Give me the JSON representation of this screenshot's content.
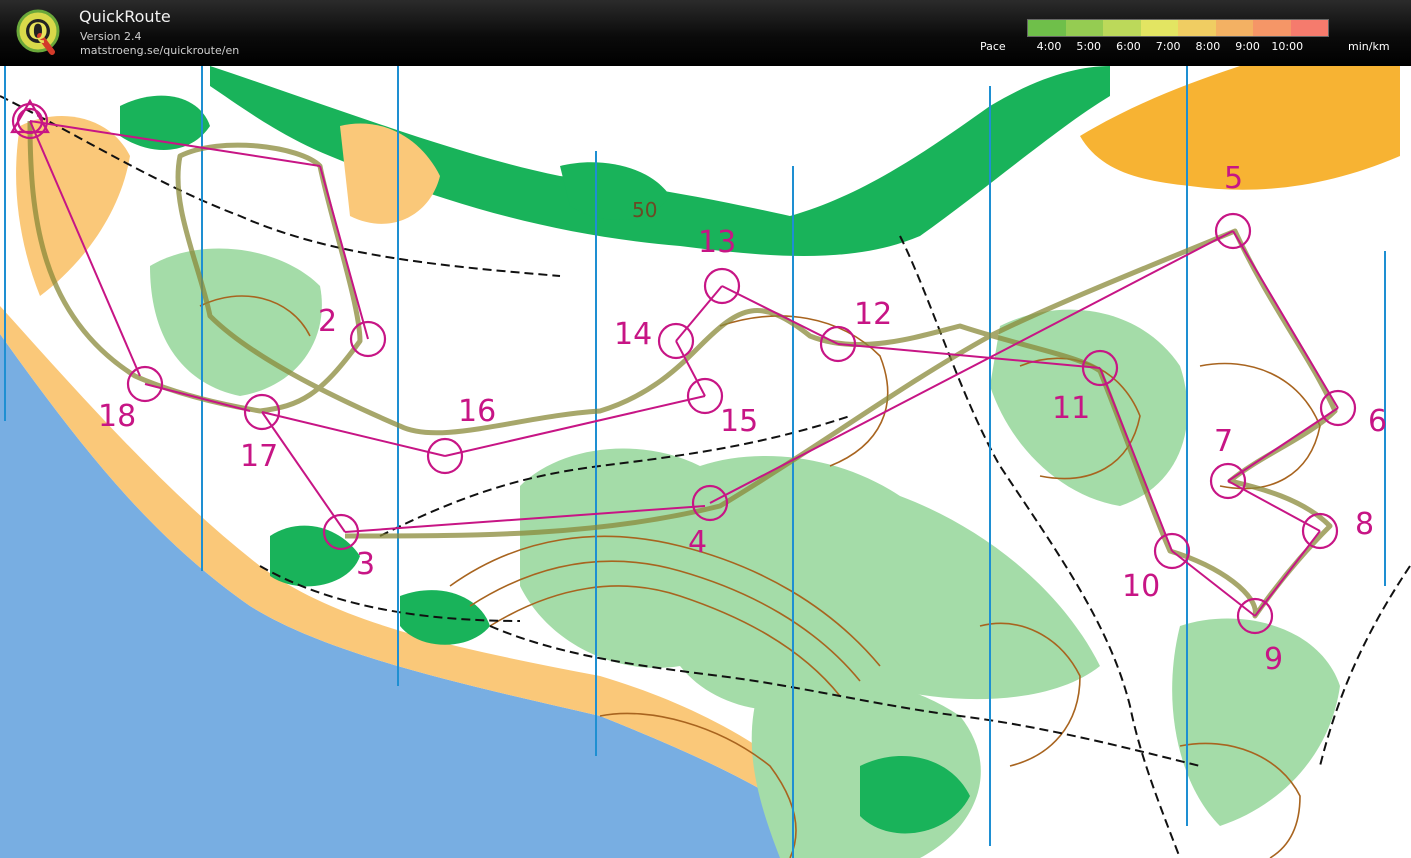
{
  "app": {
    "title": "QuickRoute",
    "version": "Version 2.4",
    "url": "matstroeng.se/quickroute/en",
    "logo_letter": "Q"
  },
  "pace": {
    "label": "Pace",
    "ticks": [
      "4:00",
      "5:00",
      "6:00",
      "7:00",
      "8:00",
      "9:00",
      "10:00"
    ],
    "unit": "min/km",
    "colors": [
      "#6fbf4a",
      "#95cc52",
      "#bcd95a",
      "#e3e562",
      "#f0cd62",
      "#f3b163",
      "#f59667",
      "#f57b6d"
    ]
  },
  "map": {
    "colors": {
      "water": "#78aee2",
      "forest_dark": "#19b35a",
      "forest_light": "#a4dca8",
      "open": "#fac879",
      "open_bright": "#f7b333",
      "contour": "#a8641f",
      "course": "#c71585",
      "route": "#8a8a3a",
      "meridian": "#1e8fd2"
    },
    "contour_label": "50",
    "controls": [
      "2",
      "3",
      "4",
      "5",
      "6",
      "7",
      "8",
      "9",
      "10",
      "11",
      "12",
      "13",
      "14",
      "15",
      "16",
      "17",
      "18"
    ]
  }
}
